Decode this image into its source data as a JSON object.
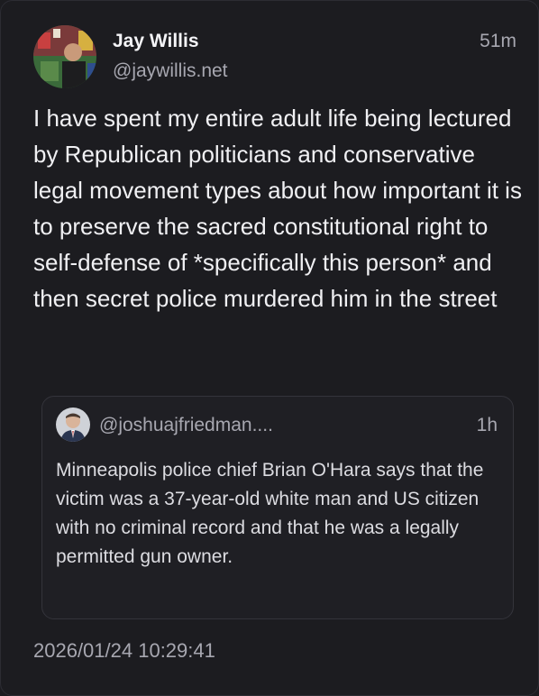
{
  "post": {
    "author_name": "Jay Willis",
    "author_handle": "@jaywillis.net",
    "relative_time": "51m",
    "text": "I have spent my entire adult life being lectured by Republican politicians and conservative legal movement types about how important it is to preserve the sacred constitutional right to self-defense of *specifically this person* and then secret police murdered him in the street",
    "timestamp": "2026/01/24 10:29:41"
  },
  "quoted_post": {
    "author_handle": "@joshuajfriedman....",
    "relative_time": "1h",
    "text": "Minneapolis police chief Brian O'Hara says that the victim was a 37-year-old white man and US citizen with no criminal record and that he was a legally permitted gun owner."
  },
  "colors": {
    "background": "#1c1c20",
    "text_primary": "#f0f0f3",
    "text_secondary": "#a7a7b0",
    "quote_border": "#34343b"
  }
}
